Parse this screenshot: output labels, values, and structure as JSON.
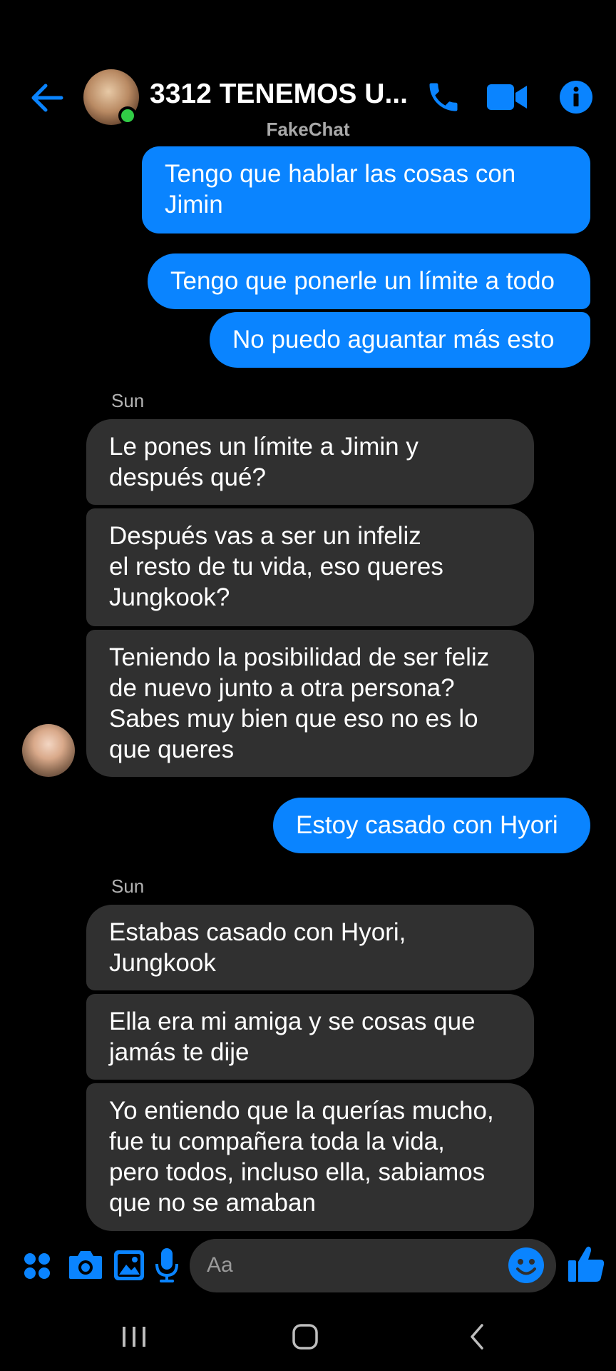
{
  "header": {
    "title": "3312 TENEMOS U...",
    "subtitle": "FakeChat",
    "accent": "#0a84ff",
    "online_color": "#31cc46"
  },
  "messages": [
    {
      "type": "outgoing",
      "text": "Tengo que hablar las cosas con\nJimin"
    },
    {
      "type": "outgoing",
      "text": "Tengo que ponerle un límite a todo"
    },
    {
      "type": "outgoing",
      "text": "No puedo aguantar más esto"
    },
    {
      "type": "sender",
      "text": "Sun"
    },
    {
      "type": "incoming",
      "text": "Le pones un límite a Jimin y\ndespués qué?"
    },
    {
      "type": "incoming",
      "text": "Después vas a ser un infeliz\nel resto de tu vida, eso queres\nJungkook?"
    },
    {
      "type": "incoming",
      "text": "Teniendo la posibilidad de ser feliz\nde nuevo junto a otra persona?\nSabes muy bien que eso no es lo\nque queres"
    },
    {
      "type": "outgoing",
      "text": "Estoy casado con Hyori"
    },
    {
      "type": "sender",
      "text": "Sun"
    },
    {
      "type": "incoming",
      "text": "Estabas casado con Hyori,\nJungkook"
    },
    {
      "type": "incoming",
      "text": "Ella era mi amiga y se cosas que\njamás te dije"
    },
    {
      "type": "incoming",
      "text": "Yo entiendo que la querías mucho,\nfue tu compañera toda la vida,\npero todos, incluso ella, sabiamos\nque no se amaban"
    }
  ],
  "composer": {
    "placeholder": "Aa"
  },
  "icons": [
    "back-arrow-icon",
    "phone-icon",
    "video-camera-icon",
    "info-icon",
    "apps-icon",
    "camera-icon",
    "gallery-icon",
    "microphone-icon",
    "emoji-icon",
    "thumbs-up-icon",
    "recents-icon",
    "home-icon",
    "back-icon"
  ]
}
